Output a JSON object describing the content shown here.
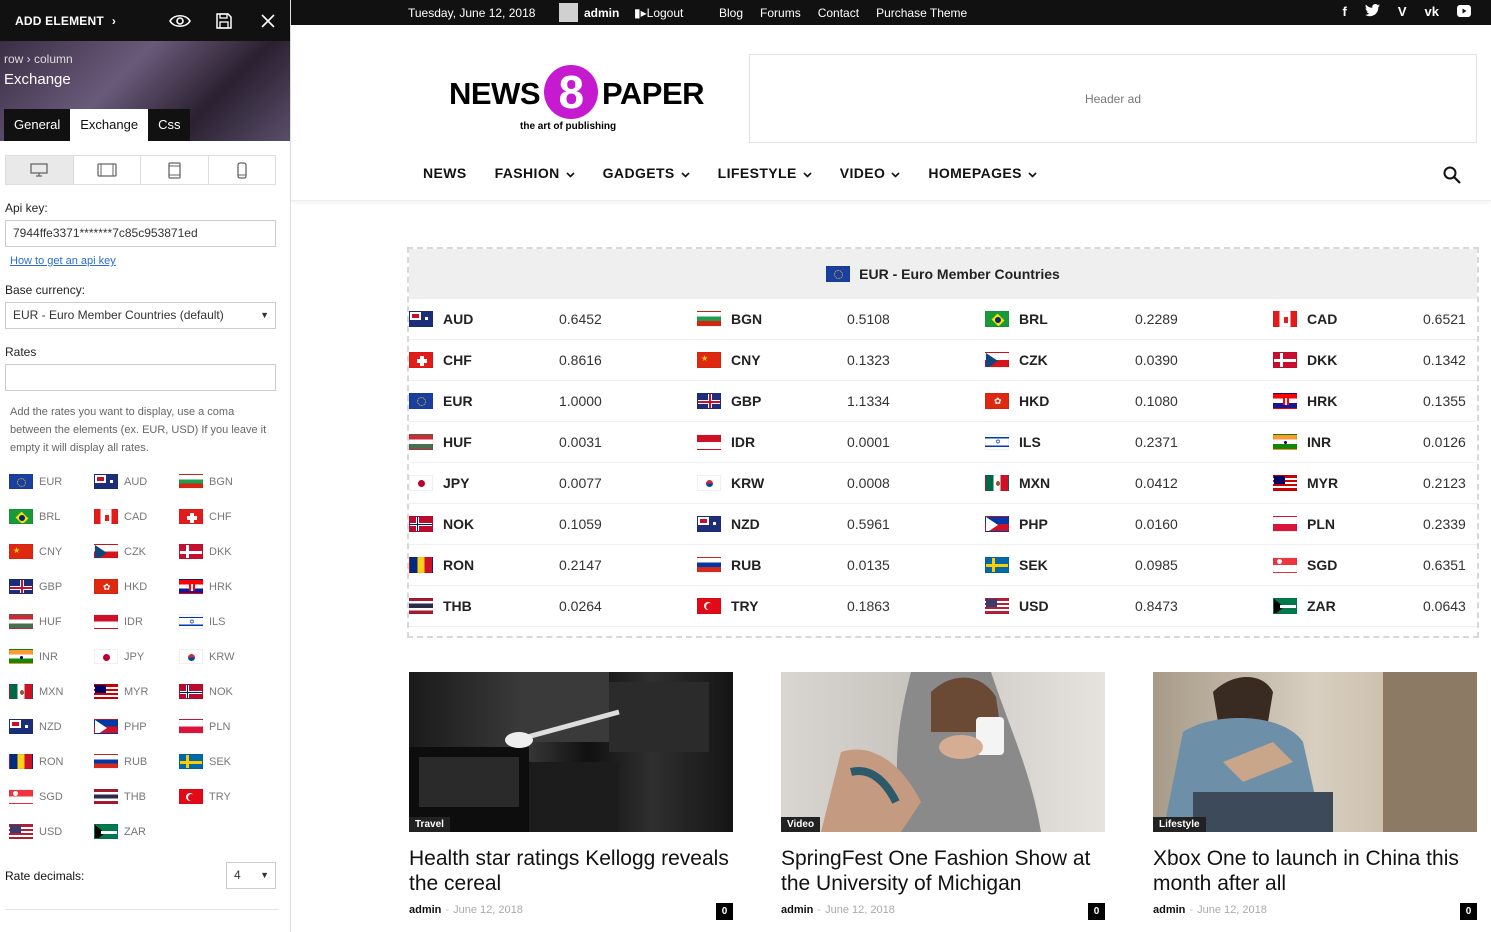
{
  "panel": {
    "add_element": "ADD ELEMENT",
    "breadcrumb": "row › column",
    "title": "Exchange",
    "tabs": [
      "General",
      "Exchange",
      "Css"
    ],
    "active_tab": "Exchange",
    "api_key_label": "Api key:",
    "api_key_value": "7944ffe3371*******7c85c953871ed",
    "api_link": "How to get an api key",
    "base_currency_label": "Base currency:",
    "base_currency_value": "EUR - Euro Member Countries (default)",
    "rates_label": "Rates",
    "rates_value": "",
    "rates_help": "Add the rates you want to display, use a coma between the elements (ex. EUR, USD) If you leave it empty it will display all rates.",
    "currencies": [
      "EUR",
      "AUD",
      "BGN",
      "BRL",
      "CAD",
      "CHF",
      "CNY",
      "CZK",
      "DKK",
      "GBP",
      "HKD",
      "HRK",
      "HUF",
      "IDR",
      "ILS",
      "INR",
      "JPY",
      "KRW",
      "MXN",
      "MYR",
      "NOK",
      "NZD",
      "PHP",
      "PLN",
      "RON",
      "RUB",
      "SEK",
      "SGD",
      "THB",
      "TRY",
      "USD",
      "ZAR"
    ],
    "decimals_label": "Rate decimals:",
    "decimals_value": "4"
  },
  "topbar": {
    "date": "Tuesday, June 12, 2018",
    "user": "admin",
    "logout": "Logout",
    "menu": [
      "Blog",
      "Forums",
      "Contact",
      "Purchase Theme"
    ],
    "social": [
      "facebook-icon",
      "twitter-icon",
      "vimeo-icon",
      "vk-icon",
      "youtube-icon"
    ]
  },
  "logo": {
    "left": "NEWS",
    "digit": "8",
    "right": "PAPER",
    "tagline": "the art of publishing"
  },
  "header_ad": "Header ad",
  "nav": [
    {
      "label": "NEWS",
      "dropdown": false
    },
    {
      "label": "FASHION",
      "dropdown": true
    },
    {
      "label": "GADGETS",
      "dropdown": true
    },
    {
      "label": "LIFESTYLE",
      "dropdown": true
    },
    {
      "label": "VIDEO",
      "dropdown": true
    },
    {
      "label": "HOMEPAGES",
      "dropdown": true
    }
  ],
  "exchange": {
    "base": "EUR - Euro Member Countries",
    "rates": [
      {
        "code": "AUD",
        "value": "0.6452"
      },
      {
        "code": "BGN",
        "value": "0.5108"
      },
      {
        "code": "BRL",
        "value": "0.2289"
      },
      {
        "code": "CAD",
        "value": "0.6521"
      },
      {
        "code": "CHF",
        "value": "0.8616"
      },
      {
        "code": "CNY",
        "value": "0.1323"
      },
      {
        "code": "CZK",
        "value": "0.0390"
      },
      {
        "code": "DKK",
        "value": "0.1342"
      },
      {
        "code": "EUR",
        "value": "1.0000"
      },
      {
        "code": "GBP",
        "value": "1.1334"
      },
      {
        "code": "HKD",
        "value": "0.1080"
      },
      {
        "code": "HRK",
        "value": "0.1355"
      },
      {
        "code": "HUF",
        "value": "0.0031"
      },
      {
        "code": "IDR",
        "value": "0.0001"
      },
      {
        "code": "ILS",
        "value": "0.2371"
      },
      {
        "code": "INR",
        "value": "0.0126"
      },
      {
        "code": "JPY",
        "value": "0.0077"
      },
      {
        "code": "KRW",
        "value": "0.0008"
      },
      {
        "code": "MXN",
        "value": "0.0412"
      },
      {
        "code": "MYR",
        "value": "0.2123"
      },
      {
        "code": "NOK",
        "value": "0.1059"
      },
      {
        "code": "NZD",
        "value": "0.5961"
      },
      {
        "code": "PHP",
        "value": "0.0160"
      },
      {
        "code": "PLN",
        "value": "0.2339"
      },
      {
        "code": "RON",
        "value": "0.2147"
      },
      {
        "code": "RUB",
        "value": "0.0135"
      },
      {
        "code": "SEK",
        "value": "0.0985"
      },
      {
        "code": "SGD",
        "value": "0.6351"
      },
      {
        "code": "THB",
        "value": "0.0264"
      },
      {
        "code": "TRY",
        "value": "0.1863"
      },
      {
        "code": "USD",
        "value": "0.8473"
      },
      {
        "code": "ZAR",
        "value": "0.0643"
      }
    ]
  },
  "articles": [
    {
      "category": "Travel",
      "title": "Health star ratings Kellogg reveals the cereal",
      "author": "admin",
      "date": "June 12, 2018",
      "comments": "0"
    },
    {
      "category": "Video",
      "title": "SpringFest One Fashion Show at the University of Michigan",
      "author": "admin",
      "date": "June 12, 2018",
      "comments": "0"
    },
    {
      "category": "Lifestyle",
      "title": "Xbox One to launch in China this month after all",
      "author": "admin",
      "date": "June 12, 2018",
      "comments": "0"
    }
  ],
  "colors": {
    "brand": "#c51ad0",
    "topbar": "#111111",
    "link": "#2a6ed0"
  }
}
